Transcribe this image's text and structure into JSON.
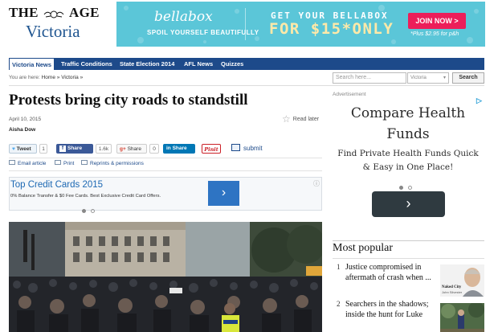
{
  "masthead": {
    "top": "THE",
    "age": "AGE",
    "edition": "Victoria"
  },
  "top_ad": {
    "brand": "bellabox",
    "tagline": "SPOIL YOURSELF BEAUTIFULLY",
    "headline1": "GET YOUR BELLABOX",
    "headline2": "FOR $15*ONLY",
    "cta": "JOIN NOW >",
    "fine_print": "*Plus $2.95 for p&h",
    "bg_color": "#5bc6d8",
    "cta_color": "#ec1e5a"
  },
  "nav": {
    "items": [
      {
        "label": "Victoria News"
      },
      {
        "label": "Traffic Conditions"
      },
      {
        "label": "State Election 2014"
      },
      {
        "label": "AFL News"
      },
      {
        "label": "Quizzes"
      }
    ],
    "color": "#1d4a8a"
  },
  "breadcrumb": {
    "prefix": "You are here:",
    "home": "Home",
    "sep": "»",
    "section": "Victoria"
  },
  "search": {
    "placeholder": "Search here...",
    "scope": "Victoria",
    "button": "Search"
  },
  "article": {
    "headline": "Protests bring city roads to standstill",
    "date": "April 10, 2015",
    "read_later": "Read later",
    "author": "Aisha Dow"
  },
  "share": {
    "tweet": "Tweet",
    "tweet_count": "1",
    "facebook": "Share",
    "facebook_count": "1.6k",
    "gplus_label": "Share",
    "gplus_count": "0",
    "linkedin": "Share",
    "pinterest": "Pinit",
    "submit": "submit"
  },
  "tools": {
    "email": "Email article",
    "print": "Print",
    "reprints": "Reprints & permissions"
  },
  "inline_ad": {
    "title": "Top Credit Cards 2015",
    "desc": "0% Balance Transfer & $0 Fee Cards. Best Exclusive Credit Card Offers.",
    "arrow": "›"
  },
  "sidebar_ad": {
    "label": "Advertisement",
    "title": "Compare Health Funds",
    "subtitle": "Find Private Health Funds Quick & Easy in One Place!",
    "arrow": "›"
  },
  "most_popular": {
    "heading": "Most popular",
    "items": [
      {
        "num": "1",
        "title": "Justice compromised in aftermath of crash when ...",
        "thumb_title": "Naked City",
        "thumb_byline": "John Silvester"
      },
      {
        "num": "2",
        "title": "Searchers in the shadows; inside the hunt for Luke"
      }
    ]
  }
}
